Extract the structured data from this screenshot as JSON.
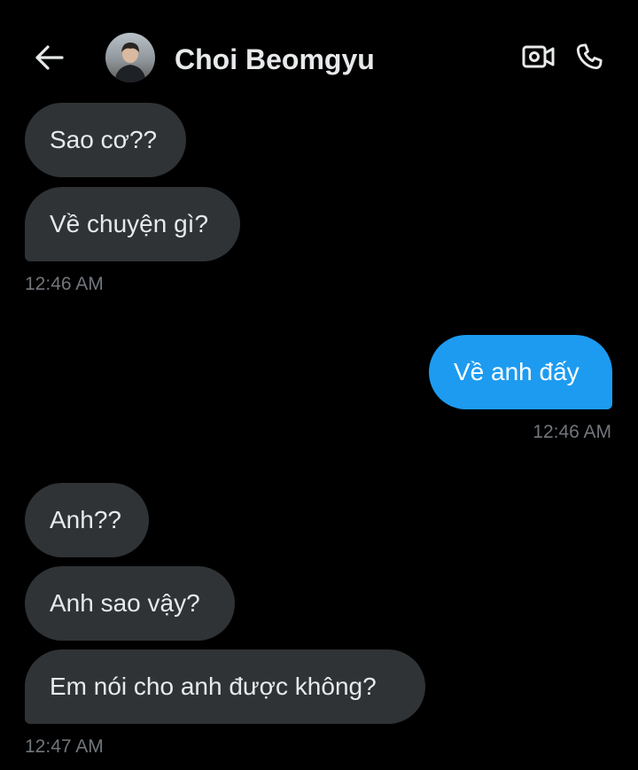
{
  "header": {
    "contact_name": "Choi Beomgyu",
    "back_icon": "arrow-left-icon",
    "video_icon": "video-camera-icon",
    "call_icon": "phone-icon"
  },
  "messages": [
    {
      "direction": "incoming",
      "text": "Sao cơ??"
    },
    {
      "direction": "incoming",
      "text": "Về chuyện gì?"
    },
    {
      "direction": "incoming",
      "text": "Anh??"
    },
    {
      "direction": "incoming",
      "text": "Anh sao vậy?"
    },
    {
      "direction": "incoming",
      "text": "Em nói cho anh được không?"
    },
    {
      "direction": "outgoing",
      "text": "Về anh đấy"
    }
  ],
  "timestamps": [
    "12:46 AM",
    "12:46 AM",
    "12:47 AM"
  ],
  "colors": {
    "background": "#000000",
    "incoming_bubble": "#2f3336",
    "outgoing_bubble": "#1d9bf0",
    "timestamp": "#71767b"
  }
}
